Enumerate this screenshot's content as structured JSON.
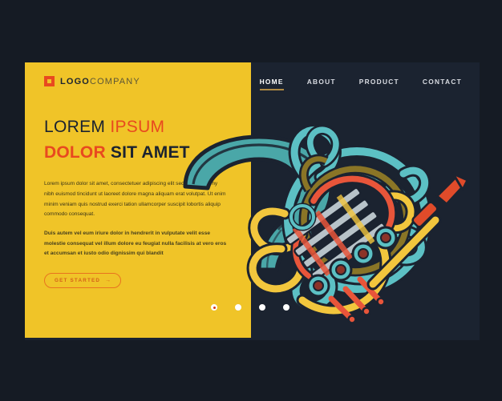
{
  "page": {
    "background_color": "#151b24",
    "card_background_color": "#1b2330",
    "panel_color": "#f0c428",
    "accent_color": "#e8491f",
    "underline_color": "#b08a43"
  },
  "header": {
    "logo": {
      "mark_name": "square-logo-mark",
      "text_bold": "LOGO",
      "text_light": "COMPANY"
    },
    "nav": [
      {
        "label": "HOME",
        "active": true
      },
      {
        "label": "ABOUT",
        "active": false
      },
      {
        "label": "PRODUCT",
        "active": false
      },
      {
        "label": "CONTACT",
        "active": false
      }
    ]
  },
  "hero": {
    "headline_line1_plain": "LOREM ",
    "headline_line1_accent": "IPSUM",
    "headline_line2_accent": "DOLOR ",
    "headline_line2_plain": "SIT AMET",
    "paragraph_1": "Lorem ipsum dolor sit amet, consectetuer adipiscing elit sed diam nonumy nibh euismod tincidunt ut laoreet dolore magna aliquam erat volutpat. Ut enim minim veniam quis nostrud exerci tation ullamcorper suscipit lobortis aliquip commodo consequat.",
    "paragraph_2": "Duis autem vel eum iriure dolor in hendrerit in vulputate velit esse molestie consequat vel illum dolore eu feugiat nulla facilisis at vero eros et accumsan et iusto odio dignissim qui blandit",
    "cta_label": "GET STARTED",
    "cta_arrow": "→"
  },
  "carousel": {
    "dots": [
      {
        "active": true
      },
      {
        "active": false
      },
      {
        "active": false
      },
      {
        "active": false
      }
    ]
  },
  "illustration": {
    "name": "french-horn-illustration",
    "colors": {
      "bell_teal": "#4aa7a8",
      "tube_teal": "#5cc0c4",
      "tube_yellow": "#f2c63d",
      "tube_olive": "#8a7526",
      "tube_red": "#e8553a",
      "slide_gray": "#b8c3c9",
      "mouthpiece_red": "#e04b2a",
      "outline_dark": "#1b2330",
      "rotor_center": "#8c3328"
    }
  }
}
